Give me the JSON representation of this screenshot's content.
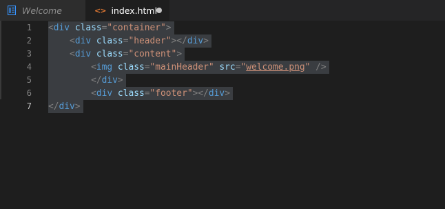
{
  "tabs": [
    {
      "label": "Welcome",
      "icon": "welcome-icon",
      "active": false
    },
    {
      "label": "index.html",
      "icon": "html-file-icon",
      "active": true,
      "unsaved": true
    }
  ],
  "editor": {
    "line_numbers": [
      "1",
      "2",
      "3",
      "4",
      "5",
      "6",
      "7"
    ],
    "active_line": "7",
    "lines": [
      [
        {
          "t": "<",
          "c": "punct"
        },
        {
          "t": "div",
          "c": "tag"
        },
        {
          "t": " "
        },
        {
          "t": "class",
          "c": "attr"
        },
        {
          "t": "=",
          "c": "punct"
        },
        {
          "t": "\"container\"",
          "c": "str"
        },
        {
          "t": ">",
          "c": "punct"
        }
      ],
      [
        {
          "t": "    "
        },
        {
          "t": "<",
          "c": "punct"
        },
        {
          "t": "div",
          "c": "tag"
        },
        {
          "t": " "
        },
        {
          "t": "class",
          "c": "attr"
        },
        {
          "t": "=",
          "c": "punct"
        },
        {
          "t": "\"header\"",
          "c": "str"
        },
        {
          "t": "></",
          "c": "punct"
        },
        {
          "t": "div",
          "c": "tag"
        },
        {
          "t": ">",
          "c": "punct"
        }
      ],
      [
        {
          "t": "    "
        },
        {
          "t": "<",
          "c": "punct"
        },
        {
          "t": "div",
          "c": "tag"
        },
        {
          "t": " "
        },
        {
          "t": "class",
          "c": "attr"
        },
        {
          "t": "=",
          "c": "punct"
        },
        {
          "t": "\"content\"",
          "c": "str"
        },
        {
          "t": ">",
          "c": "punct"
        }
      ],
      [
        {
          "t": "        "
        },
        {
          "t": "<",
          "c": "punct"
        },
        {
          "t": "img",
          "c": "tag"
        },
        {
          "t": " "
        },
        {
          "t": "class",
          "c": "attr"
        },
        {
          "t": "=",
          "c": "punct"
        },
        {
          "t": "\"mainHeader\"",
          "c": "str"
        },
        {
          "t": " "
        },
        {
          "t": "src",
          "c": "attr"
        },
        {
          "t": "=",
          "c": "punct"
        },
        {
          "t": "\"",
          "c": "str"
        },
        {
          "t": "welcome.png",
          "c": "link"
        },
        {
          "t": "\"",
          "c": "str"
        },
        {
          "t": " "
        },
        {
          "t": "/>",
          "c": "punct"
        }
      ],
      [
        {
          "t": "        "
        },
        {
          "t": "</",
          "c": "punct"
        },
        {
          "t": "div",
          "c": "tag"
        },
        {
          "t": ">",
          "c": "punct"
        }
      ],
      [
        {
          "t": "        "
        },
        {
          "t": "<",
          "c": "punct"
        },
        {
          "t": "div",
          "c": "tag"
        },
        {
          "t": " "
        },
        {
          "t": "class",
          "c": "attr"
        },
        {
          "t": "=",
          "c": "punct"
        },
        {
          "t": "\"footer\"",
          "c": "str"
        },
        {
          "t": "></",
          "c": "punct"
        },
        {
          "t": "div",
          "c": "tag"
        },
        {
          "t": ">",
          "c": "punct"
        }
      ],
      [
        {
          "t": "</",
          "c": "punct"
        },
        {
          "t": "div",
          "c": "tag"
        },
        {
          "t": ">",
          "c": "punct"
        }
      ]
    ]
  },
  "colors": {
    "background": "#1e1e1e",
    "tag": "#569cd6",
    "attribute": "#9cdcfe",
    "string": "#ce9178",
    "punctuation": "#808080",
    "selection": "#3a3d41",
    "html_icon": "#e37933"
  }
}
